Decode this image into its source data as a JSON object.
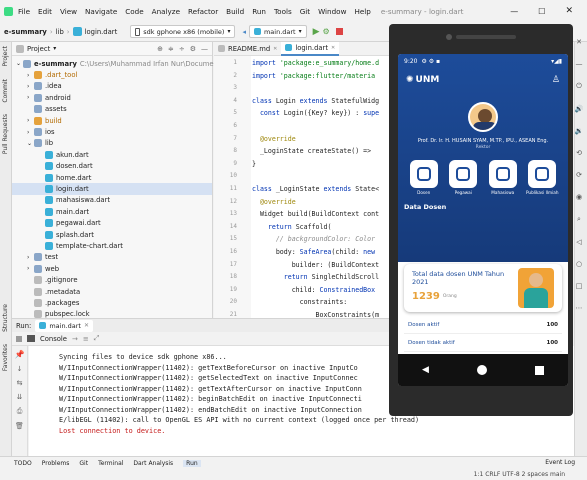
{
  "menu": {
    "items": [
      "File",
      "Edit",
      "View",
      "Navigate",
      "Code",
      "Analyze",
      "Refactor",
      "Build",
      "Run",
      "Tools",
      "Git",
      "Window",
      "Help"
    ],
    "window_title": "e-summary - login.dart"
  },
  "nav": {
    "project": "e-summary",
    "crumb_lib": "lib",
    "crumb_file": "login.dart",
    "device": "sdk gphone x86 (mobile)",
    "run_config": "main.dart"
  },
  "left_tools": [
    "Project",
    "Commit",
    "Pull Requests",
    "Structure",
    "Favorites"
  ],
  "project_panel": {
    "title": "Project",
    "root_name": "e-summary",
    "root_path": "C:\\Users\\Muhammad Irfan Nur\\Documen",
    "items": [
      {
        "name": ".dart_tool",
        "type": "folder-o",
        "indent": 1,
        "arrow": "›"
      },
      {
        "name": ".idea",
        "type": "folder",
        "indent": 1,
        "arrow": "›"
      },
      {
        "name": "android",
        "type": "folder",
        "indent": 1,
        "arrow": "›"
      },
      {
        "name": "assets",
        "type": "folder",
        "indent": 1,
        "arrow": ""
      },
      {
        "name": "build",
        "type": "folder-o",
        "indent": 1,
        "arrow": "›"
      },
      {
        "name": "ios",
        "type": "folder",
        "indent": 1,
        "arrow": "›"
      },
      {
        "name": "lib",
        "type": "folder",
        "indent": 1,
        "arrow": "⌄"
      },
      {
        "name": "akun.dart",
        "type": "dart",
        "indent": 2,
        "arrow": ""
      },
      {
        "name": "dosen.dart",
        "type": "dart",
        "indent": 2,
        "arrow": ""
      },
      {
        "name": "home.dart",
        "type": "dart",
        "indent": 2,
        "arrow": ""
      },
      {
        "name": "login.dart",
        "type": "dart",
        "indent": 2,
        "arrow": "",
        "selected": true
      },
      {
        "name": "mahasiswa.dart",
        "type": "dart",
        "indent": 2,
        "arrow": ""
      },
      {
        "name": "main.dart",
        "type": "dart",
        "indent": 2,
        "arrow": ""
      },
      {
        "name": "pegawai.dart",
        "type": "dart",
        "indent": 2,
        "arrow": ""
      },
      {
        "name": "splash.dart",
        "type": "dart",
        "indent": 2,
        "arrow": ""
      },
      {
        "name": "template-chart.dart",
        "type": "dart",
        "indent": 2,
        "arrow": ""
      },
      {
        "name": "test",
        "type": "folder",
        "indent": 1,
        "arrow": "›"
      },
      {
        "name": "web",
        "type": "folder",
        "indent": 1,
        "arrow": "›"
      },
      {
        "name": ".gitignore",
        "type": "file",
        "indent": 1,
        "arrow": ""
      },
      {
        "name": ".metadata",
        "type": "file",
        "indent": 1,
        "arrow": ""
      },
      {
        "name": ".packages",
        "type": "file",
        "indent": 1,
        "arrow": ""
      },
      {
        "name": "pubspec.lock",
        "type": "file",
        "indent": 1,
        "arrow": ""
      },
      {
        "name": "pubspec.yaml",
        "type": "file",
        "indent": 1,
        "arrow": ""
      }
    ]
  },
  "editor": {
    "tabs": [
      "README.md",
      "login.dart"
    ],
    "lines": [
      {
        "n": "1",
        "html": "<span class='kw'>import</span> <span class='str'>'package:e_summary/home.d</span>"
      },
      {
        "n": "2",
        "html": "<span class='kw'>import</span> <span class='str'>'package:flutter/materia</span>"
      },
      {
        "n": "3",
        "html": ""
      },
      {
        "n": "4",
        "html": "<span class='kw'>class</span> Login <span class='kw'>extends</span> StatefulWidg"
      },
      {
        "n": "5",
        "html": "  <span class='kw'>const</span> Login({Key? key}) : <span class='kw'>supe</span>"
      },
      {
        "n": "6",
        "html": ""
      },
      {
        "n": "7",
        "html": "  <span class='an'>@override</span>"
      },
      {
        "n": "8",
        "html": "  _LoginState createState() =&gt; "
      },
      {
        "n": "9",
        "html": "}"
      },
      {
        "n": "10",
        "html": ""
      },
      {
        "n": "11",
        "html": "<span class='kw'>class</span> _LoginState <span class='kw'>extends</span> State&lt;"
      },
      {
        "n": "12",
        "html": "  <span class='an'>@override</span>"
      },
      {
        "n": "13",
        "html": "  Widget build(BuildContext cont"
      },
      {
        "n": "14",
        "html": "    <span class='kw'>return</span> Scaffold("
      },
      {
        "n": "15",
        "html": "      <span class='cm'>// backgroundColor: Color</span>"
      },
      {
        "n": "16",
        "html": "      body: <span class='kw'>SafeArea</span>(child: <span class='kw'>new</span>"
      },
      {
        "n": "17",
        "html": "          builder: (BuildContext"
      },
      {
        "n": "18",
        "html": "        <span class='kw'>return</span> SingleChildScroll"
      },
      {
        "n": "19",
        "html": "          child: <span class='kw'>ConstrainedBox</span>"
      },
      {
        "n": "20",
        "html": "            constraints:"
      },
      {
        "n": "21",
        "html": "                BoxConstraints(m"
      },
      {
        "n": "22",
        "html": "            child: Padding("
      },
      {
        "n": "23",
        "html": "              padding: <span class='kw'>const</span> Edg"
      }
    ]
  },
  "run": {
    "label": "Run:",
    "config": "main.dart",
    "console_tab": "Console"
  },
  "console": {
    "lines": [
      {
        "text": "Syncing files to device sdk gphone x86...",
        "err": false
      },
      {
        "text": "W/IInputConnectionWrapper(11402): getTextBeforeCursor on inactive InputCo",
        "err": false
      },
      {
        "text": "W/IInputConnectionWrapper(11402): getSelectedText on inactive InputConnec",
        "err": false
      },
      {
        "text": "W/IInputConnectionWrapper(11402): getTextAfterCursor on inactive InputConn",
        "err": false
      },
      {
        "text": "W/IInputConnectionWrapper(11402): beginBatchEdit on inactive InputConnecti",
        "err": false
      },
      {
        "text": "W/IInputConnectionWrapper(11402): endBatchEdit on inactive InputConnection",
        "err": false
      },
      {
        "text": "E/libEGL  (11402): call to OpenGL ES API with no current context (logged once per thread)",
        "err": false
      },
      {
        "text": "Lost connection to device.",
        "err": true
      }
    ]
  },
  "status": {
    "tabs": [
      "TODO",
      "Problems",
      "Git",
      "Terminal",
      "Dart Analysis",
      "Run"
    ],
    "event_log": "Event Log",
    "position": "1:1  CRLF  UTF-8  2 spaces  main"
  },
  "phone": {
    "time": "9:20",
    "brand": "UNM",
    "profile_name": "Prof. Dr. Ir. H. HUSAIN SYAM, M.TP., IPU., ASEAN Eng.",
    "profile_role": "Rektor",
    "menu": [
      "Dosen",
      "Pegawai",
      "Mahasiswa",
      "Publikasi Ilmiah"
    ],
    "section_title": "Data Dosen",
    "card_title": "Total data dosen UNM Tahun 2021",
    "card_value": "1239",
    "card_unit": "Orang",
    "stats": [
      {
        "label": "Dosen aktif",
        "value": "100"
      },
      {
        "label": "Dosen tidak aktif",
        "value": "100"
      }
    ],
    "colors": {
      "primary": "#1d4c9a",
      "accent": "#e8a23a"
    }
  }
}
